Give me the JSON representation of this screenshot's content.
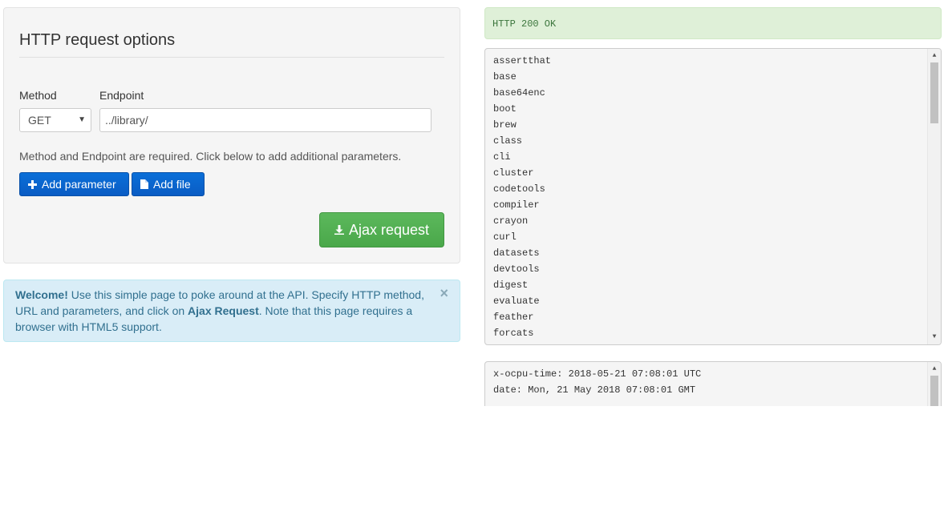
{
  "options": {
    "title": "HTTP request options",
    "method_label": "Method",
    "endpoint_label": "Endpoint",
    "method_value": "GET",
    "endpoint_value": "../library/",
    "help_text": "Method and Endpoint are required. Click below to add additional parameters.",
    "add_parameter_label": "Add parameter",
    "add_file_label": "Add file",
    "ajax_request_label": "Ajax request"
  },
  "welcome": {
    "strong": "Welcome!",
    "text_1": " Use this simple page to poke around at the API. Specify HTTP method, URL and parameters, and click on ",
    "link_strong": "Ajax Request",
    "text_2": ". Note that this page requires a browser with HTML5 support.",
    "close_label": "×"
  },
  "status": {
    "text": "HTTP 200 OK"
  },
  "body_output": [
    "assertthat",
    "base",
    "base64enc",
    "boot",
    "brew",
    "class",
    "cli",
    "cluster",
    "codetools",
    "compiler",
    "crayon",
    "curl",
    "datasets",
    "devtools",
    "digest",
    "evaluate",
    "feather",
    "forcats"
  ],
  "headers_output": [
    "x-ocpu-time: 2018-05-21 07:08:01 UTC",
    "date: Mon, 21 May 2018 07:08:01 GMT"
  ],
  "colors": {
    "primary": "#0a6fd8",
    "success": "#5cb85c",
    "info_bg": "#d9edf7",
    "status_bg": "#dff0d8"
  },
  "icons": {
    "add_parameter": "plus-icon",
    "add_file": "file-icon",
    "ajax_request": "download-icon"
  }
}
